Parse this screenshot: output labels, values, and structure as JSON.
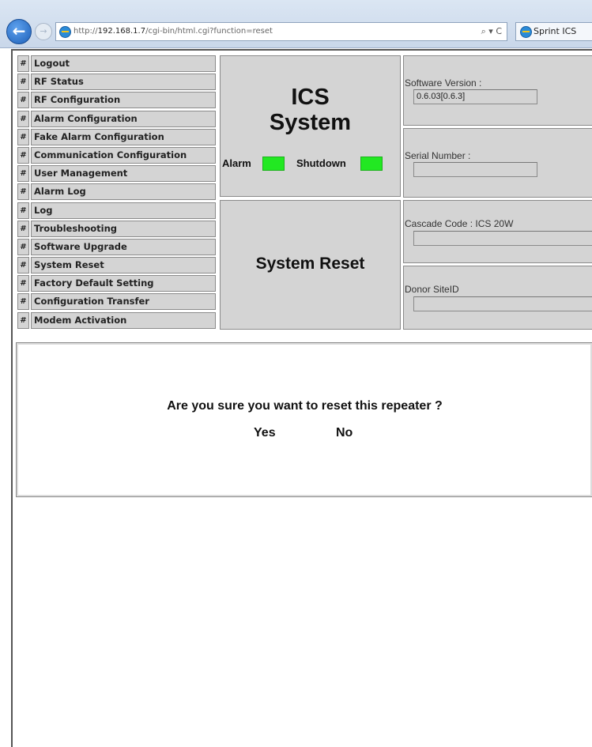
{
  "browser": {
    "url_prefix": "http://",
    "url_host": "192.168.1.7",
    "url_path": "/cgi-bin/html.cgi?function=reset",
    "address_search_glyph": "⌕ ▾ C",
    "tab_title": "Sprint ICS"
  },
  "nav": {
    "hash": "#",
    "items": [
      "Logout",
      "RF Status",
      "RF Configuration",
      "Alarm Configuration",
      "Fake Alarm Configuration",
      "Communication Configuration",
      "User Management",
      "Alarm Log",
      "Log",
      "Troubleshooting",
      "Software Upgrade",
      "System Reset",
      "Factory Default Setting",
      "Configuration Transfer",
      "Modem Activation"
    ]
  },
  "brand": {
    "line1": "ICS",
    "line2": "System",
    "alarm_label": "Alarm",
    "shutdown_label": "Shutdown",
    "led_color": "#22e822"
  },
  "page": {
    "heading": "System Reset"
  },
  "info": {
    "software_version_label": "Software Version :",
    "software_version_value": "0.6.03[0.6.3]",
    "serial_number_label": "Serial Number :",
    "serial_number_value": "",
    "cascade_code_label": "Cascade Code : ICS 20W",
    "cascade_code_value": "",
    "donor_siteid_label": "Donor SiteID",
    "donor_siteid_value": ""
  },
  "confirm": {
    "question": "Are you sure you want to reset this repeater ?",
    "yes": "Yes",
    "no": "No"
  }
}
